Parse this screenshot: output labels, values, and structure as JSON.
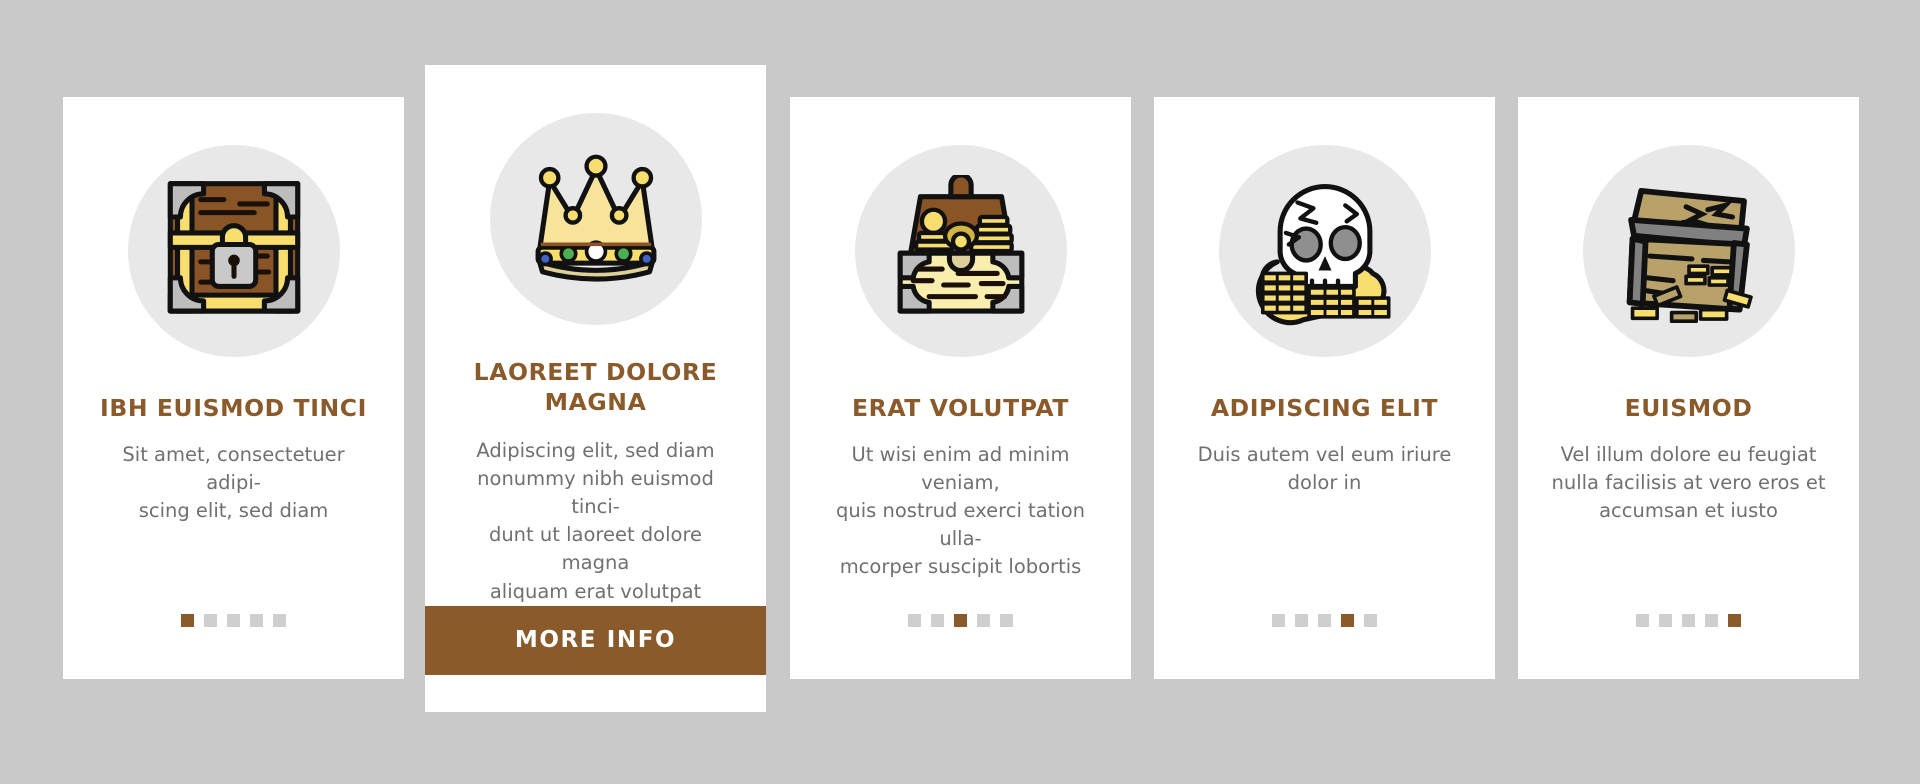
{
  "background_color": "#c9c9c9",
  "accent_color": "#8b5a2b",
  "card_background": "#ffffff",
  "icon_circle_color": "#e8e8e8",
  "body_text_color": "#707070",
  "dot_inactive_color": "#cfcfcf",
  "cards": [
    {
      "icon": "locked-treasure-chest-icon",
      "title": "IBH EUISMOD TINCI",
      "description": "Sit amet, consectetuer adipi-\nscing elit, sed diam",
      "dots": {
        "count": 5,
        "active_index": 0
      },
      "featured": false,
      "cta_label": null
    },
    {
      "icon": "crown-icon",
      "title": "LAOREET DOLORE MAGNA",
      "description": "Adipiscing elit, sed diam\nnonummy nibh euismod tinci-\ndunt ut laoreet dolore magna\naliquam erat volutpat",
      "dots": null,
      "featured": true,
      "cta_label": "MORE INFO"
    },
    {
      "icon": "open-treasure-chest-gold-icon",
      "title": "ERAT VOLUTPAT",
      "description": "Ut wisi enim ad minim veniam,\nquis nostrud exerci tation ulla-\nmcorper suscipit lobortis",
      "dots": {
        "count": 5,
        "active_index": 2
      },
      "featured": false,
      "cta_label": null
    },
    {
      "icon": "skull-with-gold-coins-icon",
      "title": "ADIPISCING ELIT",
      "description": "Duis autem vel eum iriure\ndolor in",
      "dots": {
        "count": 5,
        "active_index": 3
      },
      "featured": false,
      "cta_label": null
    },
    {
      "icon": "broken-wooden-chest-icon",
      "title": "EUISMOD",
      "description": "Vel illum dolore eu feugiat\nnulla facilisis at vero eros et\naccumsan et iusto",
      "dots": {
        "count": 5,
        "active_index": 4
      },
      "featured": false,
      "cta_label": null
    }
  ]
}
